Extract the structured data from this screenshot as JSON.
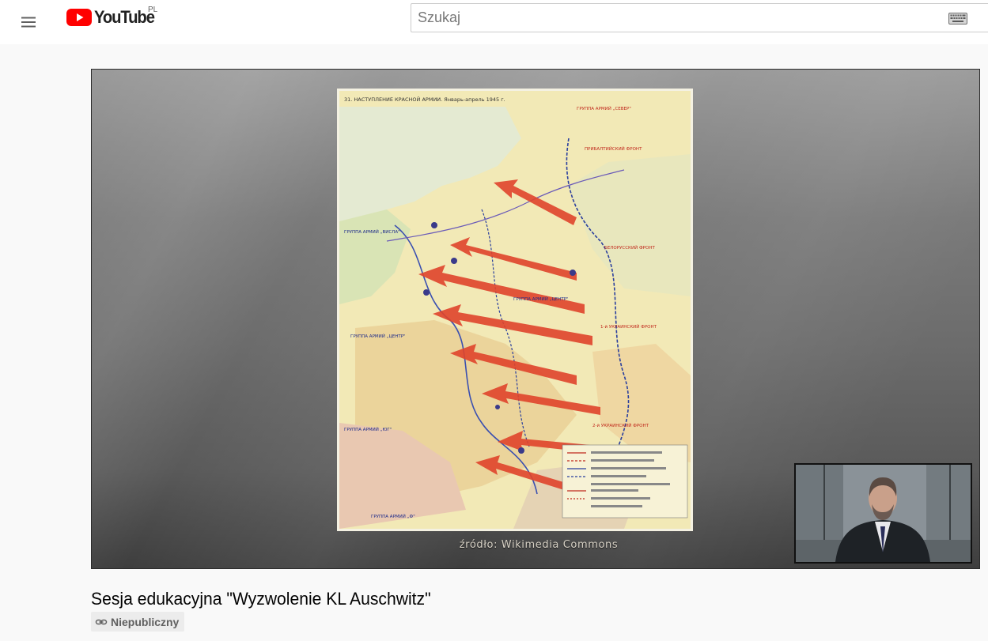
{
  "masthead": {
    "logo_text": "YouTube",
    "country_code": "PL",
    "search_placeholder": "Szukaj",
    "icons": {
      "menu": "hamburger-menu-icon",
      "logo": "youtube-play-icon",
      "keyboard": "keyboard-icon"
    },
    "colors": {
      "brand_red": "#ff0000"
    }
  },
  "player": {
    "map_header": "31. НАСТУПЛЕНИЕ КРАСНОЙ АРМИИ. Январь-апрель 1945 г.",
    "caption": "źródło: Wikimedia Commons"
  },
  "video": {
    "title": "Sesja edukacyjna \"Wyzwolenie KL Auschwitz\"",
    "visibility_label": "Niepubliczny",
    "visibility_icon": "link-icon"
  }
}
